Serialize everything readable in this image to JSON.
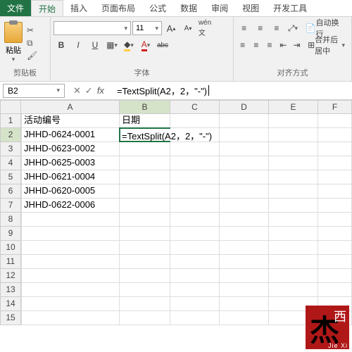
{
  "tabs": {
    "file": "文件",
    "home": "开始",
    "insert": "插入",
    "layout": "页面布局",
    "formulas": "公式",
    "data": "数据",
    "review": "审阅",
    "view": "视图",
    "dev": "开发工具"
  },
  "ribbon": {
    "clipboard_label": "剪贴板",
    "paste_label": "粘贴",
    "font_label": "字体",
    "align_label": "对齐方式",
    "font_name": "",
    "font_size": "11",
    "bold": "B",
    "italic": "I",
    "underline": "U",
    "strike": "abc",
    "grow": "A",
    "shrink": "A",
    "wrap": "自动换行",
    "merge": "合并后居中"
  },
  "fbar": {
    "namebox": "B2",
    "cancel": "✕",
    "enter": "✓",
    "fx": "fx",
    "formula": "=TextSplit(A2，2，\"-\")"
  },
  "columns": [
    "A",
    "B",
    "C",
    "D",
    "E",
    "F"
  ],
  "rows": [
    {
      "n": "1",
      "a": "活动编号",
      "b": "日期"
    },
    {
      "n": "2",
      "a": "JHHD-0624-0001",
      "b": "=TextSplit(A2，2，\"-\")"
    },
    {
      "n": "3",
      "a": "JHHD-0623-0002"
    },
    {
      "n": "4",
      "a": "JHHD-0625-0003"
    },
    {
      "n": "5",
      "a": "JHHD-0621-0004"
    },
    {
      "n": "6",
      "a": "JHHD-0620-0005"
    },
    {
      "n": "7",
      "a": "JHHD-0622-0006"
    },
    {
      "n": "8"
    },
    {
      "n": "9"
    },
    {
      "n": "10"
    },
    {
      "n": "11"
    },
    {
      "n": "12"
    },
    {
      "n": "13"
    },
    {
      "n": "14"
    },
    {
      "n": "15"
    }
  ],
  "watermark": {
    "char": "杰",
    "xi": "西",
    "pinyin": "Jie Xi"
  },
  "selected": {
    "col": "B",
    "row": 2
  }
}
